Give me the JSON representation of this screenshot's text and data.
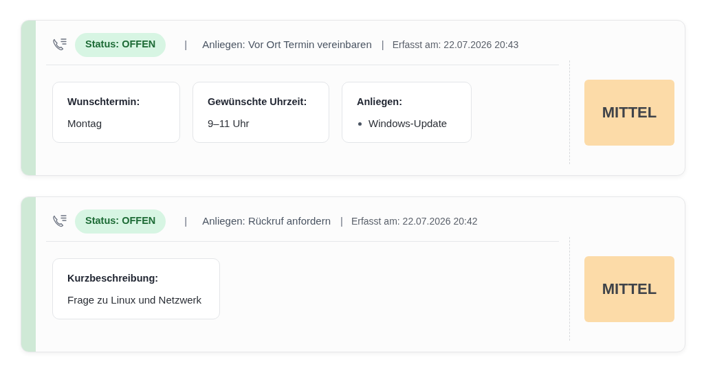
{
  "tickets": [
    {
      "status": "Status: OFFEN",
      "separator_1": "|",
      "topic": "Anliegen: Vor Ort Termin vereinbaren",
      "separator_2": "|",
      "recorded": "Erfasst am: 22.07.2026 20:43",
      "fields": [
        {
          "kind": "text",
          "label": "Wunschtermin:",
          "value": "Montag"
        },
        {
          "kind": "text",
          "label": "Gewünschte Uhrzeit:",
          "value": "9–11 Uhr"
        },
        {
          "kind": "list",
          "label": "Anliegen:",
          "items": [
            "Windows-Update"
          ]
        }
      ],
      "priority": "MITTEL"
    },
    {
      "status": "Status: OFFEN",
      "separator_1": "|",
      "topic": "Anliegen: Rückruf anfordern",
      "separator_2": "|",
      "recorded": "Erfasst am: 22.07.2026 20:42",
      "fields": [
        {
          "kind": "text",
          "label": "Kurzbeschreibung:",
          "value": "Frage zu Linux und Netzwerk"
        }
      ],
      "priority": "MITTEL"
    }
  ]
}
